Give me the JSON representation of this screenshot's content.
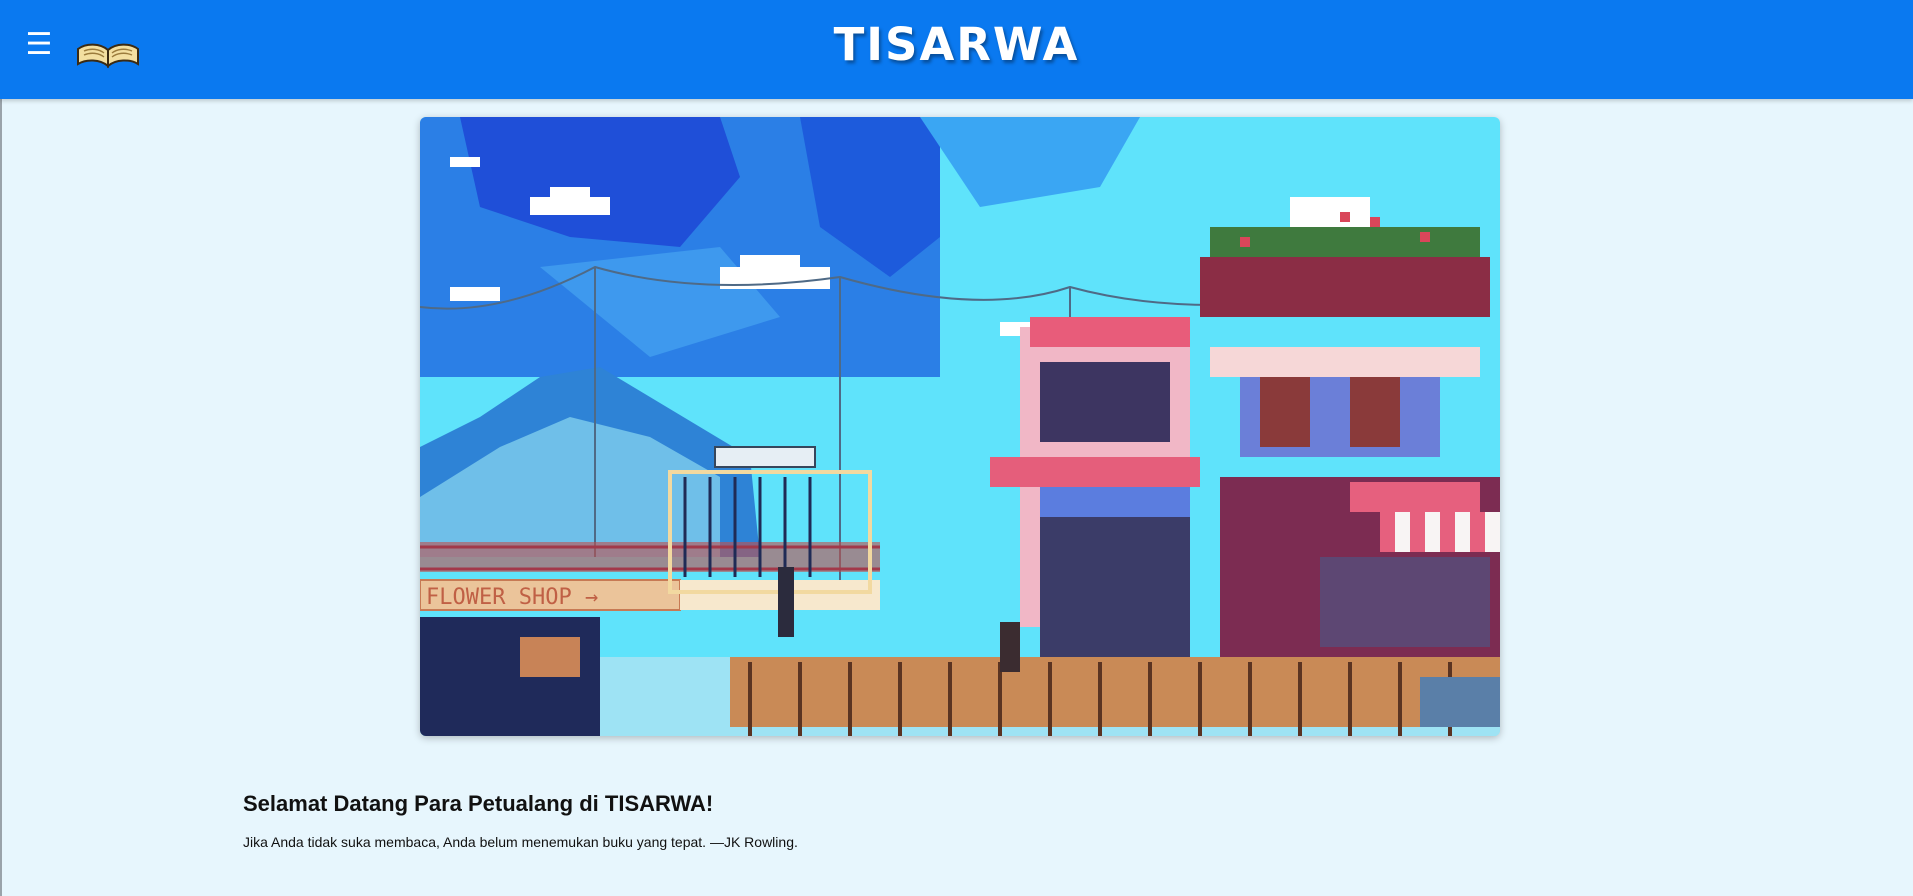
{
  "header": {
    "title": "TISARWA",
    "menu_icon": "menu-hamburger-icon",
    "menu_glyph": "☰",
    "logo_icon": "open-book-icon",
    "background_color": "#0a79f0"
  },
  "hero": {
    "image_subject": "pixel-art harbour flower shop illustration",
    "sign_text": "FLOWER SHOP →"
  },
  "main": {
    "welcome_heading": "Selamat Datang Para Petualang di TISARWA!",
    "quote": "Jika Anda tidak suka membaca, Anda belum menemukan buku yang tepat. —JK Rowling."
  },
  "colors": {
    "page_background": "#e7f6fd",
    "text": "#111111"
  }
}
